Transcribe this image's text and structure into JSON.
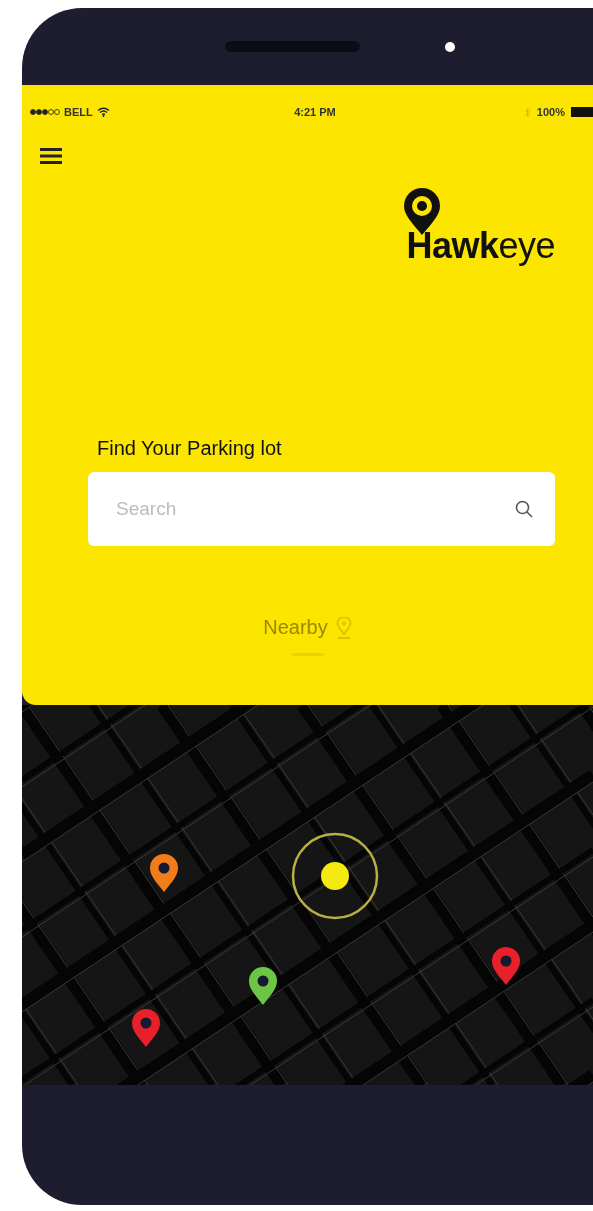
{
  "status_bar": {
    "carrier": "BELL",
    "time": "4:21 PM",
    "battery": "100%"
  },
  "logo": {
    "part_1": "Hawk",
    "part_2": "eye"
  },
  "search": {
    "title": "Find Your Parking lot",
    "placeholder": "Search"
  },
  "nearby": {
    "label": "Nearby"
  },
  "map": {
    "pins": [
      {
        "color": "#f07d1a"
      },
      {
        "color": "#6cc644"
      },
      {
        "color": "#e8202a"
      },
      {
        "color": "#e8202a"
      }
    ]
  }
}
